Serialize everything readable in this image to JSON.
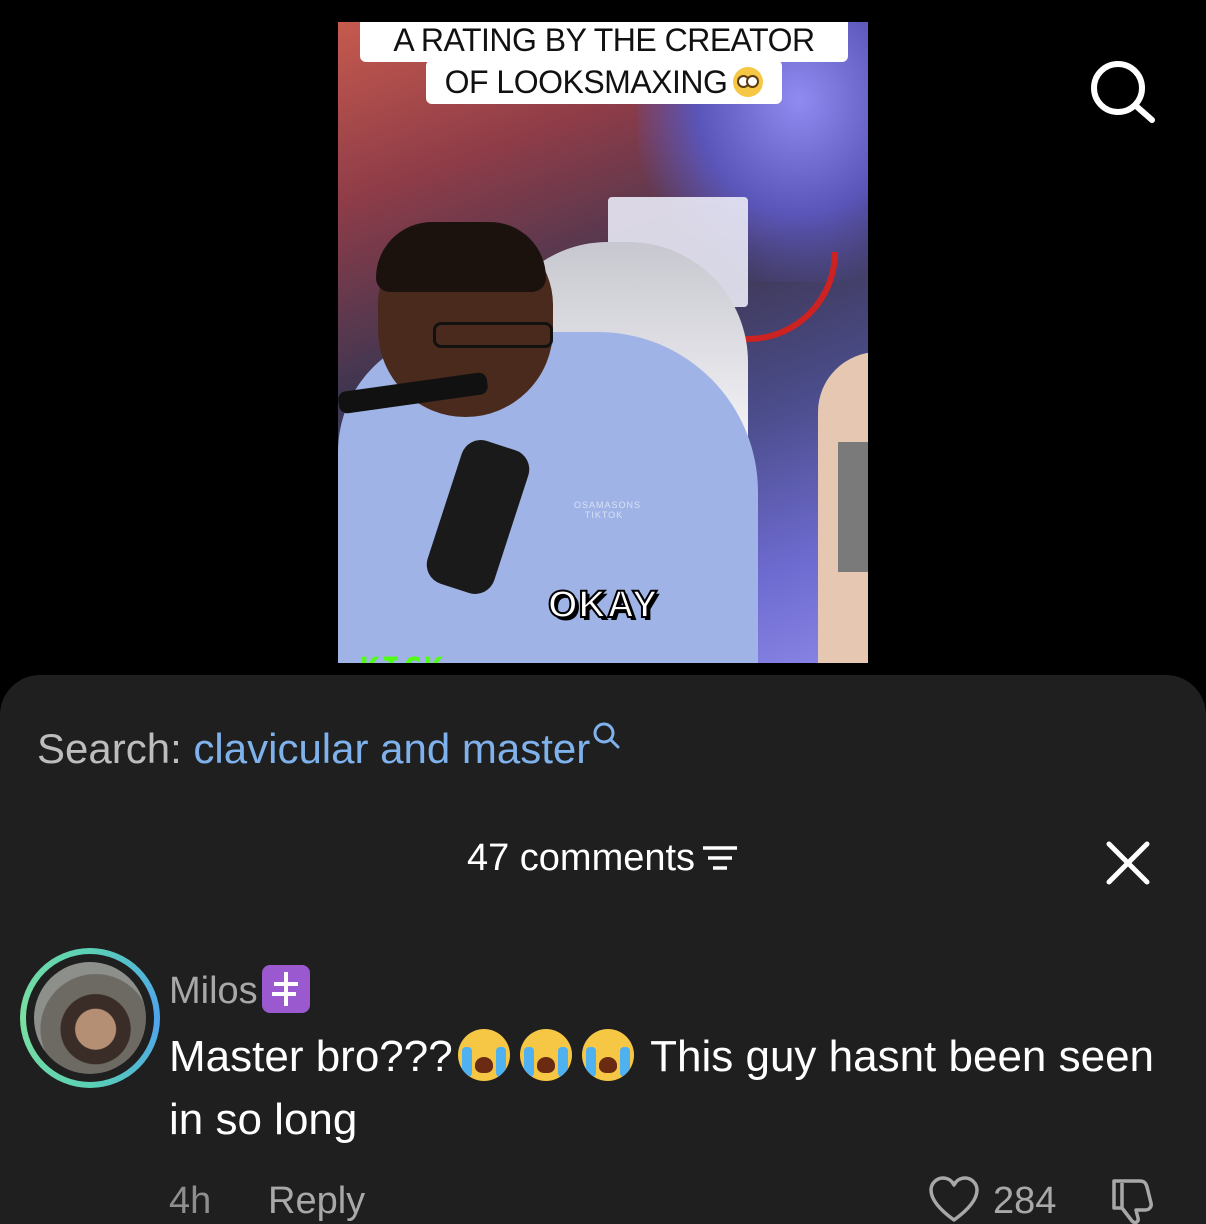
{
  "video": {
    "title_line1": "A RATING BY THE CREATOR",
    "title_line2": "OF LOOKSMAXING",
    "title_emoji": "flushed-face-emoji",
    "caption": "OKAY",
    "watermark_line1": "OSAMASONS",
    "watermark_line2": "TIKTOK",
    "corner_logo": "KICK"
  },
  "top_bar": {
    "search_icon": "search-icon"
  },
  "sheet": {
    "search_prefix": "Search:",
    "search_query": "clavicular and master",
    "comments_count_label": "47 comments",
    "sort_icon": "sort-icon",
    "close_icon": "close-icon"
  },
  "comment": {
    "username": "Milos",
    "badge_icon": "orthodox-cross-icon",
    "text_before": "Master bro???",
    "emoji": "loudly-crying-face-emoji",
    "emoji_count": 3,
    "text_after": " This guy hasnt been seen in so long",
    "time": "4h",
    "reply_label": "Reply",
    "like_count": "284",
    "like_icon": "heart-icon",
    "dislike_icon": "thumbs-down-icon"
  },
  "colors": {
    "sheet_bg": "#1f1f1f",
    "search_query": "#7fb2ec",
    "muted_text": "#a8a8a8",
    "badge": "#9b59d0",
    "avatar_ring": "#5ad0b5"
  }
}
